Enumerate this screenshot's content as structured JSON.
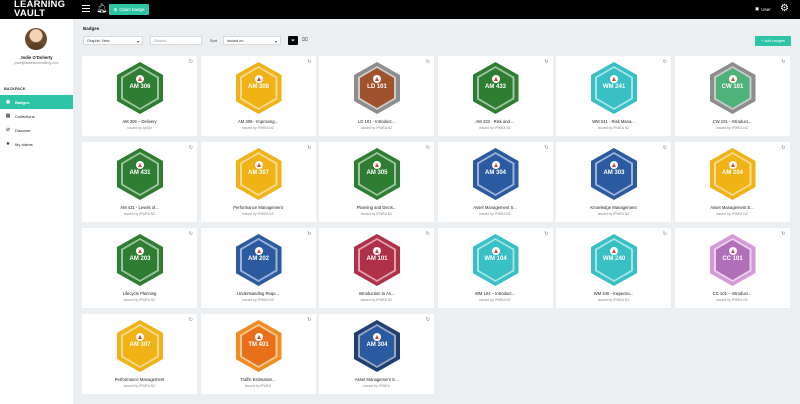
{
  "app": {
    "logo_line1": "LEARNING",
    "logo_line2": "VAULT",
    "claim_label": "Claim badge",
    "user_label": "User"
  },
  "profile": {
    "name": "Jodie O'Doherty",
    "email": "jodie@assetsconsulting.com"
  },
  "sidebar": {
    "section": "BACKPACK",
    "items": [
      {
        "label": "Badges",
        "icon": "badge-icon",
        "active": true
      },
      {
        "label": "Collections",
        "icon": "calendar-icon",
        "active": false
      },
      {
        "label": "Discover",
        "icon": "compass-icon",
        "active": false
      },
      {
        "label": "My claims",
        "icon": "star-icon",
        "active": false
      }
    ]
  },
  "main": {
    "title": "Badges",
    "view_select": "Graphic View",
    "search_placeholder": "Search...",
    "sort_label": "Sort",
    "sort_select": "Issued on",
    "add_button": "Add badges"
  },
  "cards": [
    {
      "code": "AM 306",
      "title": "AM 306 – Delivery",
      "issuer": "Issued by ApSpl",
      "outer": "#2e7d32",
      "inner": "#2e7d32",
      "pos": [
        0,
        0
      ]
    },
    {
      "code": "AM 308",
      "title": "AM 308 - Improving...",
      "issuer": "Issued by IPWEA NZ",
      "outer": "#f0b214",
      "inner": "#f0b214",
      "pos": [
        1,
        0
      ]
    },
    {
      "code": "LD 101",
      "title": "LD 101 - Introduct...",
      "issuer": "Issued by IPWEA NZ",
      "outer": "#8d8d8d",
      "inner": "#a0522d",
      "pos": [
        2,
        0
      ]
    },
    {
      "code": "AM 433",
      "title": "AM 433 - Risk and ...",
      "issuer": "Issued by IPWEA NZ",
      "outer": "#2e7d32",
      "inner": "#2e7d32",
      "pos": [
        3,
        0
      ]
    },
    {
      "code": "WM 241",
      "title": "WM 241 - Risk Mana...",
      "issuer": "Issued by IPWEA NZ",
      "outer": "#38c0c4",
      "inner": "#38c0c4",
      "pos": [
        4,
        0
      ]
    },
    {
      "code": "CW 101",
      "title": "CW 101 - Introduct...",
      "issuer": "Issued by IPWEA NZ",
      "outer": "#8d8d8d",
      "inner": "#4db37a",
      "pos": [
        5,
        0
      ]
    },
    {
      "code": "AM 431",
      "title": "AM 431 - Levels of...",
      "issuer": "Issued by IPWEA NZ",
      "outer": "#2e7d32",
      "inner": "#2e7d32",
      "pos": [
        0,
        1
      ]
    },
    {
      "code": "AM 307",
      "title": "Performance Management",
      "issuer": "Issued by IPWEA NZ",
      "outer": "#f0b214",
      "inner": "#f0b214",
      "pos": [
        1,
        1
      ]
    },
    {
      "code": "AM 305",
      "title": "Planning and Decis...",
      "issuer": "Issued by IPWEA NZ",
      "outer": "#2e7d32",
      "inner": "#2e7d32",
      "pos": [
        2,
        1
      ]
    },
    {
      "code": "AM 304",
      "title": "Asset Management S...",
      "issuer": "Issued by IPWEA NZ",
      "outer": "#2b5aa0",
      "inner": "#2b5aa0",
      "pos": [
        3,
        1
      ]
    },
    {
      "code": "AM 303",
      "title": "Knowledge Management",
      "issuer": "Issued by IPWEA NZ",
      "outer": "#2b5aa0",
      "inner": "#2b5aa0",
      "pos": [
        4,
        1
      ]
    },
    {
      "code": "AM 204",
      "title": "Asset Management E...",
      "issuer": "Issued by IPWEA NZ",
      "outer": "#f0b214",
      "inner": "#f0b214",
      "pos": [
        5,
        1
      ]
    },
    {
      "code": "AM 203",
      "title": "Lifecycle Planning",
      "issuer": "Issued by IPWEA NZ",
      "outer": "#2e7d32",
      "inner": "#2e7d32",
      "pos": [
        0,
        2
      ]
    },
    {
      "code": "AM 202",
      "title": "Understanding Requ...",
      "issuer": "Issued by IPWEA NZ",
      "outer": "#2b5aa0",
      "inner": "#2b5aa0",
      "pos": [
        1,
        2
      ]
    },
    {
      "code": "AM 101",
      "title": "Introduction to As...",
      "issuer": "Issued by IPWEA NZ",
      "outer": "#b0304a",
      "inner": "#b0304a",
      "pos": [
        2,
        2
      ]
    },
    {
      "code": "WM 104",
      "title": "WM 104 – Introduct...",
      "issuer": "Issued by IPWEA NZ",
      "outer": "#38c0c4",
      "inner": "#38c0c4",
      "pos": [
        3,
        2
      ]
    },
    {
      "code": "WM 240",
      "title": "WM 240 - Inspectio...",
      "issuer": "Issued by IPWEA NZ",
      "outer": "#38c0c4",
      "inner": "#38c0c4",
      "pos": [
        4,
        2
      ]
    },
    {
      "code": "CC 101",
      "title": "CC 101 – Introduct...",
      "issuer": "Issued by IPWEA NZ",
      "outer": "#d39ad8",
      "inner": "#b06fb8",
      "pos": [
        5,
        2
      ]
    },
    {
      "code": "AM 307",
      "title": "Performance Management",
      "issuer": "Issued by IPWEA NZ",
      "outer": "#f0b214",
      "inner": "#f0b214",
      "pos": [
        0,
        3
      ]
    },
    {
      "code": "TM 401",
      "title": "Traffic Estimation...",
      "issuer": "Issued by IPWEA",
      "outer": "#f28c1e",
      "inner": "#e8701a",
      "pos": [
        1,
        3
      ]
    },
    {
      "code": "AM 304",
      "title": "Asset Management S...",
      "issuer": "Issued by IPWEA",
      "outer": "#1f3f70",
      "inner": "#2b5aa0",
      "pos": [
        2,
        3
      ]
    }
  ]
}
